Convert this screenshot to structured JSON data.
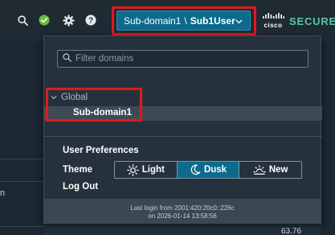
{
  "topbar": {
    "icons": [
      "search-icon",
      "check-circle-icon",
      "gear-icon",
      "help-icon"
    ],
    "status_color": "#6cbe3c",
    "domain_selector": {
      "domain": "Sub-domain1",
      "separator": "\\",
      "user": "Sub1User"
    },
    "brand": {
      "logo_word": "cisco",
      "product": "SECURE"
    }
  },
  "background": {
    "left_text": "n",
    "right_value": "63.76"
  },
  "dropdown": {
    "filter_placeholder": "Filter domains",
    "filter_value": "",
    "tree": {
      "root": "Global",
      "children": [
        "Sub-domain1"
      ],
      "selected": "Sub-domain1"
    },
    "preferences": {
      "title": "User Preferences",
      "theme_label": "Theme",
      "themes": [
        "Light",
        "Dusk",
        "New"
      ],
      "active_theme": "Dusk",
      "logout": "Log Out"
    },
    "footer": {
      "line1": "Last login from 2001:420:20c0::226c",
      "line2": "on 2026-01-14 13:58:56"
    }
  },
  "colors": {
    "accent": "#0c6a8c",
    "highlight": "#e11a1a",
    "brand_green": "#58c6a4"
  }
}
